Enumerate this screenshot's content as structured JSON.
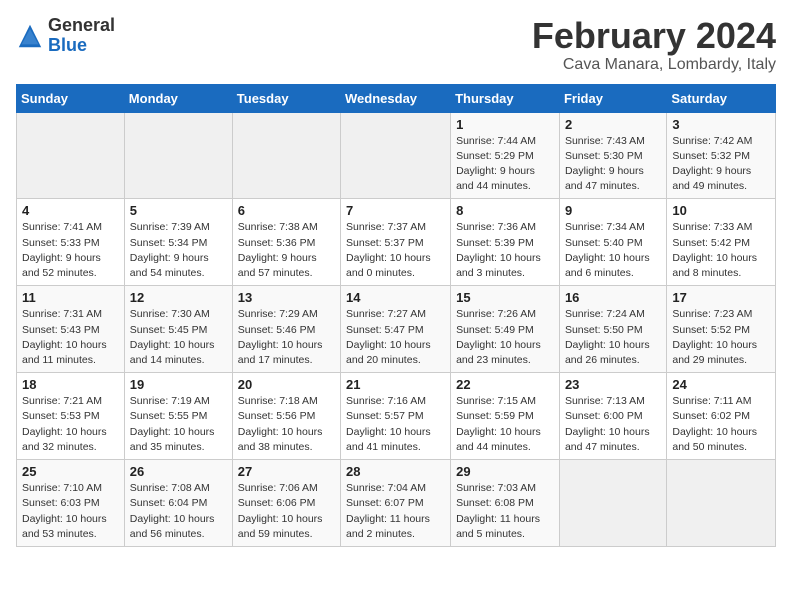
{
  "header": {
    "logo_general": "General",
    "logo_blue": "Blue",
    "month": "February 2024",
    "location": "Cava Manara, Lombardy, Italy"
  },
  "weekdays": [
    "Sunday",
    "Monday",
    "Tuesday",
    "Wednesday",
    "Thursday",
    "Friday",
    "Saturday"
  ],
  "weeks": [
    [
      {
        "day": "",
        "info": ""
      },
      {
        "day": "",
        "info": ""
      },
      {
        "day": "",
        "info": ""
      },
      {
        "day": "",
        "info": ""
      },
      {
        "day": "1",
        "info": "Sunrise: 7:44 AM\nSunset: 5:29 PM\nDaylight: 9 hours\nand 44 minutes."
      },
      {
        "day": "2",
        "info": "Sunrise: 7:43 AM\nSunset: 5:30 PM\nDaylight: 9 hours\nand 47 minutes."
      },
      {
        "day": "3",
        "info": "Sunrise: 7:42 AM\nSunset: 5:32 PM\nDaylight: 9 hours\nand 49 minutes."
      }
    ],
    [
      {
        "day": "4",
        "info": "Sunrise: 7:41 AM\nSunset: 5:33 PM\nDaylight: 9 hours\nand 52 minutes."
      },
      {
        "day": "5",
        "info": "Sunrise: 7:39 AM\nSunset: 5:34 PM\nDaylight: 9 hours\nand 54 minutes."
      },
      {
        "day": "6",
        "info": "Sunrise: 7:38 AM\nSunset: 5:36 PM\nDaylight: 9 hours\nand 57 minutes."
      },
      {
        "day": "7",
        "info": "Sunrise: 7:37 AM\nSunset: 5:37 PM\nDaylight: 10 hours\nand 0 minutes."
      },
      {
        "day": "8",
        "info": "Sunrise: 7:36 AM\nSunset: 5:39 PM\nDaylight: 10 hours\nand 3 minutes."
      },
      {
        "day": "9",
        "info": "Sunrise: 7:34 AM\nSunset: 5:40 PM\nDaylight: 10 hours\nand 6 minutes."
      },
      {
        "day": "10",
        "info": "Sunrise: 7:33 AM\nSunset: 5:42 PM\nDaylight: 10 hours\nand 8 minutes."
      }
    ],
    [
      {
        "day": "11",
        "info": "Sunrise: 7:31 AM\nSunset: 5:43 PM\nDaylight: 10 hours\nand 11 minutes."
      },
      {
        "day": "12",
        "info": "Sunrise: 7:30 AM\nSunset: 5:45 PM\nDaylight: 10 hours\nand 14 minutes."
      },
      {
        "day": "13",
        "info": "Sunrise: 7:29 AM\nSunset: 5:46 PM\nDaylight: 10 hours\nand 17 minutes."
      },
      {
        "day": "14",
        "info": "Sunrise: 7:27 AM\nSunset: 5:47 PM\nDaylight: 10 hours\nand 20 minutes."
      },
      {
        "day": "15",
        "info": "Sunrise: 7:26 AM\nSunset: 5:49 PM\nDaylight: 10 hours\nand 23 minutes."
      },
      {
        "day": "16",
        "info": "Sunrise: 7:24 AM\nSunset: 5:50 PM\nDaylight: 10 hours\nand 26 minutes."
      },
      {
        "day": "17",
        "info": "Sunrise: 7:23 AM\nSunset: 5:52 PM\nDaylight: 10 hours\nand 29 minutes."
      }
    ],
    [
      {
        "day": "18",
        "info": "Sunrise: 7:21 AM\nSunset: 5:53 PM\nDaylight: 10 hours\nand 32 minutes."
      },
      {
        "day": "19",
        "info": "Sunrise: 7:19 AM\nSunset: 5:55 PM\nDaylight: 10 hours\nand 35 minutes."
      },
      {
        "day": "20",
        "info": "Sunrise: 7:18 AM\nSunset: 5:56 PM\nDaylight: 10 hours\nand 38 minutes."
      },
      {
        "day": "21",
        "info": "Sunrise: 7:16 AM\nSunset: 5:57 PM\nDaylight: 10 hours\nand 41 minutes."
      },
      {
        "day": "22",
        "info": "Sunrise: 7:15 AM\nSunset: 5:59 PM\nDaylight: 10 hours\nand 44 minutes."
      },
      {
        "day": "23",
        "info": "Sunrise: 7:13 AM\nSunset: 6:00 PM\nDaylight: 10 hours\nand 47 minutes."
      },
      {
        "day": "24",
        "info": "Sunrise: 7:11 AM\nSunset: 6:02 PM\nDaylight: 10 hours\nand 50 minutes."
      }
    ],
    [
      {
        "day": "25",
        "info": "Sunrise: 7:10 AM\nSunset: 6:03 PM\nDaylight: 10 hours\nand 53 minutes."
      },
      {
        "day": "26",
        "info": "Sunrise: 7:08 AM\nSunset: 6:04 PM\nDaylight: 10 hours\nand 56 minutes."
      },
      {
        "day": "27",
        "info": "Sunrise: 7:06 AM\nSunset: 6:06 PM\nDaylight: 10 hours\nand 59 minutes."
      },
      {
        "day": "28",
        "info": "Sunrise: 7:04 AM\nSunset: 6:07 PM\nDaylight: 11 hours\nand 2 minutes."
      },
      {
        "day": "29",
        "info": "Sunrise: 7:03 AM\nSunset: 6:08 PM\nDaylight: 11 hours\nand 5 minutes."
      },
      {
        "day": "",
        "info": ""
      },
      {
        "day": "",
        "info": ""
      }
    ]
  ]
}
